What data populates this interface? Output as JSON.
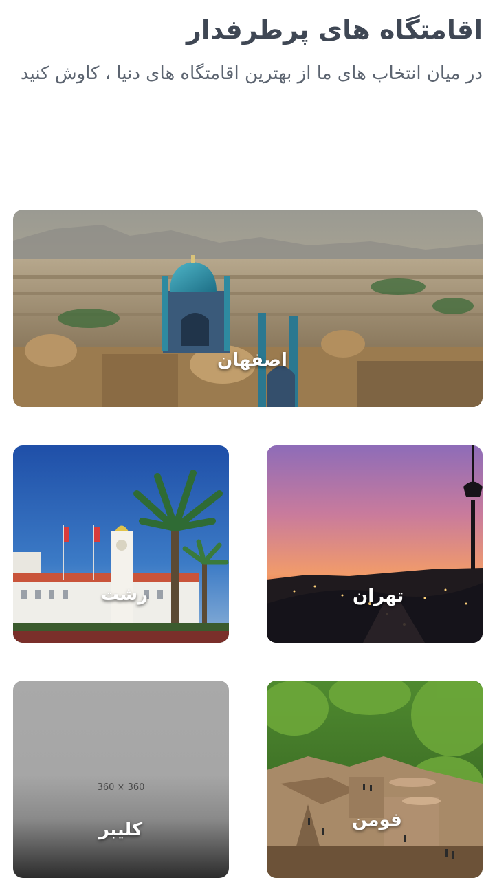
{
  "section": {
    "title": "اقامتگاه های پرطرفدار",
    "subtitle": "در میان انتخاب های ما از بهترین اقامتگاه های دنیا ، کاوش کنید"
  },
  "destinations": [
    {
      "name": "اصفهان",
      "image": "isfahan-mosque-photo"
    },
    {
      "name": "تهران",
      "image": "milad-tower-sunset-photo"
    },
    {
      "name": "رشت",
      "image": "rasht-municipality-palm-photo"
    },
    {
      "name": "فومن",
      "image": "masuleh-forest-village-photo"
    },
    {
      "name": "کلیبر",
      "image": "placeholder",
      "placeholder_text": "360 × 360"
    }
  ]
}
